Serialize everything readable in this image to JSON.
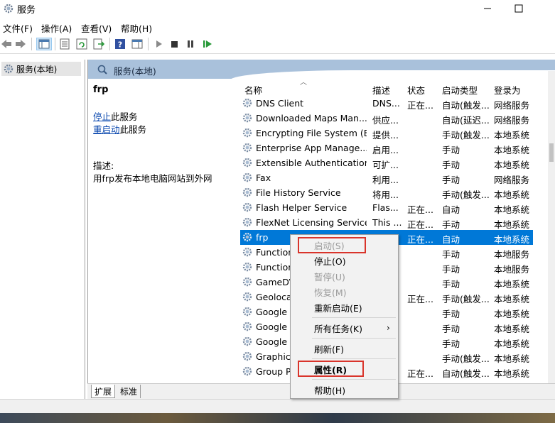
{
  "window": {
    "title": "服务"
  },
  "menubar": [
    "文件(F)",
    "操作(A)",
    "查看(V)",
    "帮助(H)"
  ],
  "tree": {
    "root_label": "服务(本地)"
  },
  "pane": {
    "header_title": "服务(本地)"
  },
  "details": {
    "service_name": "frp",
    "stop_link": "停止",
    "stop_suffix": "此服务",
    "restart_link": "重启动",
    "restart_suffix": "此服务",
    "description_label": "描述:",
    "description_text": "用frp发布本地电脑网站到外网"
  },
  "columns": {
    "name": "名称",
    "desc": "描述",
    "status": "状态",
    "startup": "启动类型",
    "logon": "登录为"
  },
  "services": [
    {
      "name": "DNS Client",
      "desc": "DNS...",
      "status": "正在...",
      "startup": "自动(触发...",
      "logon": "网络服务"
    },
    {
      "name": "Downloaded Maps Man...",
      "desc": "供应...",
      "status": "",
      "startup": "自动(延迟...",
      "logon": "网络服务"
    },
    {
      "name": "Encrypting File System (E...",
      "desc": "提供...",
      "status": "",
      "startup": "手动(触发...",
      "logon": "本地系统"
    },
    {
      "name": "Enterprise App Manage...",
      "desc": "启用...",
      "status": "",
      "startup": "手动",
      "logon": "本地系统"
    },
    {
      "name": "Extensible Authentication...",
      "desc": "可扩...",
      "status": "",
      "startup": "手动",
      "logon": "本地系统"
    },
    {
      "name": "Fax",
      "desc": "利用...",
      "status": "",
      "startup": "手动",
      "logon": "网络服务"
    },
    {
      "name": "File History Service",
      "desc": "将用...",
      "status": "",
      "startup": "手动(触发...",
      "logon": "本地系统"
    },
    {
      "name": "Flash Helper Service",
      "desc": "Flas...",
      "status": "正在...",
      "startup": "自动",
      "logon": "本地系统"
    },
    {
      "name": "FlexNet Licensing Service",
      "desc": "This ...",
      "status": "正在...",
      "startup": "手动",
      "logon": "本地系统"
    },
    {
      "name": "frp",
      "desc": "",
      "status": "正在...",
      "startup": "自动",
      "logon": "本地系统"
    },
    {
      "name": "Function",
      "desc": "",
      "status": "",
      "startup": "手动",
      "logon": "本地服务"
    },
    {
      "name": "Function",
      "desc": "",
      "status": "",
      "startup": "手动",
      "logon": "本地服务"
    },
    {
      "name": "GameDV",
      "desc": "",
      "status": "",
      "startup": "手动",
      "logon": "本地系统"
    },
    {
      "name": "Geoloca",
      "desc": "",
      "status": "正在...",
      "startup": "手动(触发...",
      "logon": "本地系统"
    },
    {
      "name": "Google",
      "desc": "",
      "status": "",
      "startup": "手动",
      "logon": "本地系统"
    },
    {
      "name": "Google",
      "desc": "",
      "status": "",
      "startup": "手动",
      "logon": "本地系统"
    },
    {
      "name": "Google",
      "desc": "",
      "status": "",
      "startup": "手动",
      "logon": "本地系统"
    },
    {
      "name": "Graphics",
      "desc": "",
      "status": "",
      "startup": "手动(触发...",
      "logon": "本地系统"
    },
    {
      "name": "Group P",
      "desc": "",
      "status": "正在...",
      "startup": "自动(触发...",
      "logon": "本地系统"
    }
  ],
  "selected_index": 9,
  "context_menu": {
    "start": "启动(S)",
    "stop": "停止(O)",
    "pause": "暂停(U)",
    "resume": "恢复(M)",
    "restart": "重新启动(E)",
    "all_tasks": "所有任务(K)",
    "refresh": "刷新(F)",
    "properties": "属性(R)",
    "help": "帮助(H)"
  },
  "tabs": {
    "extended": "扩展",
    "standard": "标准"
  },
  "colors": {
    "selection": "#0078d7",
    "highlight_box": "#d9342b",
    "pane_header": "#a9c1db"
  }
}
